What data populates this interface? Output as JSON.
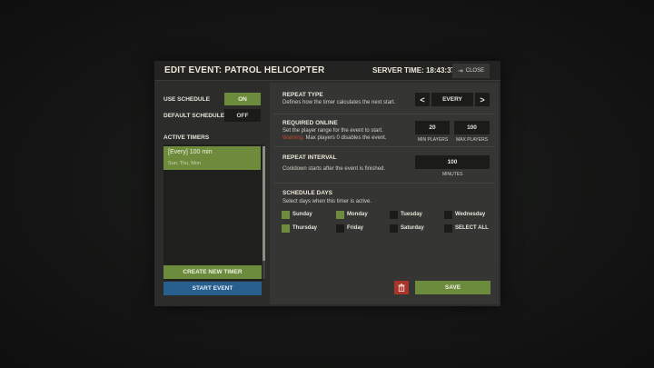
{
  "header": {
    "title": "EDIT EVENT: PATROL HELICOPTER",
    "server_time": "SERVER TIME: 18:43:37",
    "close_label": "CLOSE"
  },
  "left": {
    "use_schedule_label": "USE SCHEDULE",
    "use_schedule_value": "ON",
    "default_schedule_label": "DEFAULT SCHEDULE",
    "default_schedule_value": "OFF",
    "active_timers_label": "ACTIVE TIMERS",
    "timers": [
      {
        "name": "[Every] 100 min",
        "days": "Sun, Thu, Mon"
      }
    ],
    "create_timer_label": "CREATE NEW TIMER",
    "start_event_label": "START EVENT"
  },
  "repeat_type": {
    "title": "REPEAT TYPE",
    "desc": "Defines how the timer calculates the next start.",
    "value": "EVERY",
    "prev": "<",
    "next": ">"
  },
  "required_online": {
    "title": "REQUIRED ONLINE",
    "desc": "Set the player range for the event to start.",
    "warning_word": "Warning:",
    "warning_text": "Max players 0 disables the event.",
    "min_players": "20",
    "min_label": "MIN PLAYERS",
    "max_players": "100",
    "max_label": "MAX PLAYERS"
  },
  "repeat_interval": {
    "title": "REPEAT INTERVAL",
    "desc": "Cooldown starts after the event is finished.",
    "value": "100",
    "unit_label": "MINUTES"
  },
  "schedule_days": {
    "title": "SCHEDULE DAYS",
    "desc": "Select days when this timer is active.",
    "days": [
      {
        "label": "Sunday",
        "checked": true
      },
      {
        "label": "Monday",
        "checked": true
      },
      {
        "label": "Tuesday",
        "checked": false
      },
      {
        "label": "Wednesday",
        "checked": false
      },
      {
        "label": "Thursday",
        "checked": true
      },
      {
        "label": "Friday",
        "checked": false
      },
      {
        "label": "Saturday",
        "checked": false
      },
      {
        "label": "SELECT ALL",
        "checked": false
      }
    ]
  },
  "footer": {
    "save_label": "SAVE",
    "delete_icon": "trash-icon"
  },
  "colors": {
    "accent_green": "#6c8b3c",
    "accent_blue": "#275f8f",
    "danger_red": "#a8342a",
    "warning_red": "#c0492f"
  }
}
